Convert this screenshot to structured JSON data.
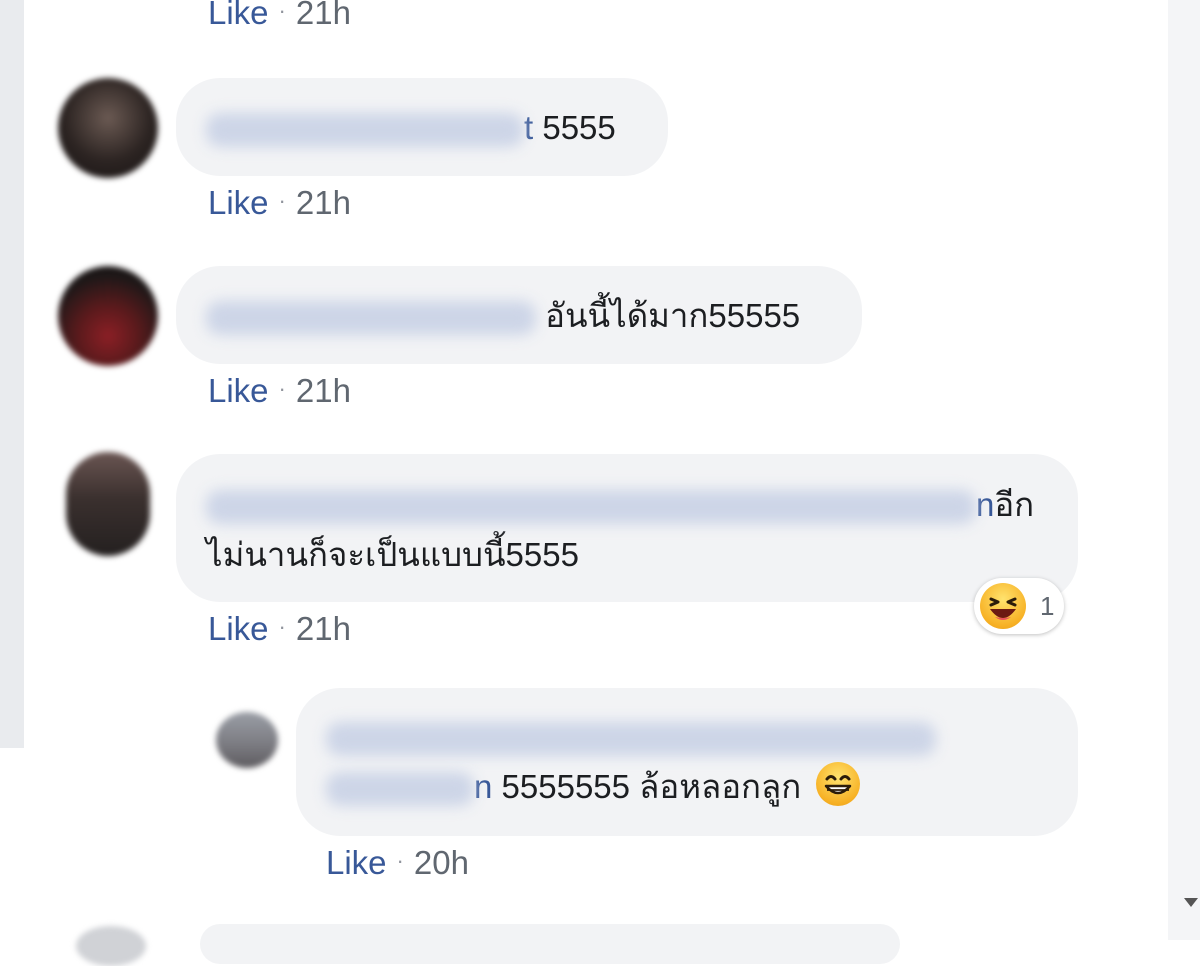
{
  "comments": [
    {
      "meta": {
        "like": "Like",
        "sep": "·",
        "time": "21h"
      }
    },
    {
      "name_tail": "t",
      "text": "5555",
      "meta": {
        "like": "Like",
        "sep": "·",
        "time": "21h"
      }
    },
    {
      "text": "อันนี้ได้มาก55555",
      "meta": {
        "like": "Like",
        "sep": "·",
        "time": "21h"
      }
    },
    {
      "name_tail": "n",
      "text_line1_suffix": "อีก",
      "text_line2": "ไม่นานก็จะเป็นแบบนี้5555",
      "reaction": {
        "icon": "laughing-emoji-icon",
        "count": "1"
      },
      "meta": {
        "like": "Like",
        "sep": "·",
        "time": "21h"
      }
    }
  ],
  "reply": {
    "name_tail": "n",
    "text": "5555555 ล้อหลอกลูก",
    "emoji": "grinning-emoji-icon",
    "meta": {
      "like": "Like",
      "sep": "·",
      "time": "20h"
    }
  },
  "colors": {
    "link": "#385898",
    "bubble": "#f2f3f5",
    "meta": "#606770",
    "gutter": "#e9ebee"
  }
}
